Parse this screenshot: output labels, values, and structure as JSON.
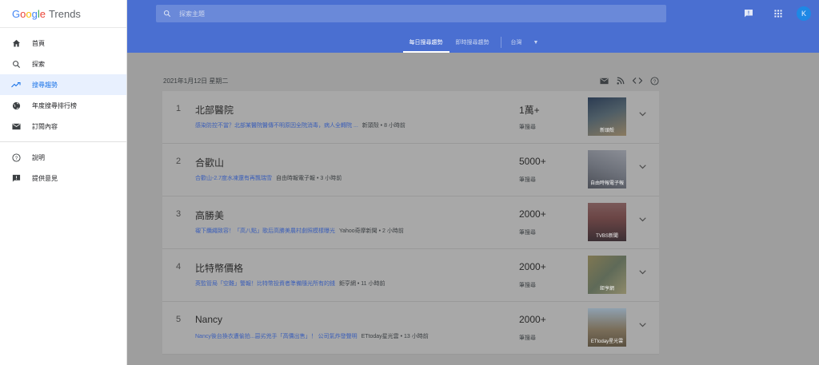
{
  "app": {
    "logo_google": "Google",
    "logo_trends": "Trends",
    "avatar_letter": "K",
    "colors": {
      "header": "#4a6fd1",
      "accent": "#1a73e8",
      "link": "#3c5fb8"
    }
  },
  "sidebar": {
    "items": [
      {
        "label": "首頁",
        "icon": "home-icon"
      },
      {
        "label": "探索",
        "icon": "search-icon"
      },
      {
        "label": "搜尋趨勢",
        "icon": "trending-icon",
        "active": true
      },
      {
        "label": "年度搜尋排行榜",
        "icon": "globe-icon"
      },
      {
        "label": "訂閱內容",
        "icon": "mail-icon"
      }
    ],
    "secondary": [
      {
        "label": "說明",
        "icon": "help-icon"
      },
      {
        "label": "提供意見",
        "icon": "feedback-icon"
      }
    ]
  },
  "header": {
    "search_placeholder": "探索主題",
    "tabs": [
      {
        "label": "每日搜尋趨勢",
        "active": true
      },
      {
        "label": "即時搜尋趨勢",
        "active": false
      }
    ],
    "region": "台灣"
  },
  "main": {
    "date": "2021年1月12日 星期二",
    "count_label": "筆搜尋",
    "trends": [
      {
        "rank": "1",
        "term": "北部醫院",
        "headline": "感染防控不當？北部某醫院醫傳不明原因全院消毒，病人全轉院 ...",
        "source": "新頭殼 • 8 小時前",
        "count": "1萬+",
        "thumb_caption": "新頭殼"
      },
      {
        "rank": "2",
        "term": "合歡山",
        "headline": "合歡山-2.7度水凍還有再飄瑞雪",
        "source": "自由時報電子報 • 3 小時前",
        "count": "5000+",
        "thumb_caption": "自由時報電子報"
      },
      {
        "rank": "3",
        "term": "高勝美",
        "headline": "襯下纜繩致容！「高八點」歌后高勝美農村劇照模樣曝光",
        "source": "Yahoo奇摩新聞 • 2 小時前",
        "count": "2000+",
        "thumb_caption": "TVBS新聞"
      },
      {
        "rank": "4",
        "term": "比特幣價格",
        "headline": "英監管局「空難」警報！比特幣投資者準備隨光所有的錢",
        "source": "鉅亨網 • 11 小時前",
        "count": "2000+",
        "thumb_caption": "鉅亨網"
      },
      {
        "rank": "5",
        "term": "Nancy",
        "headline": "Nancy後台換衣遭偷拍...惡劣兇手「高價出售」！ 公司氣炸發聲明",
        "source": "ETtoday星光雲 • 13 小時前",
        "count": "2000+",
        "thumb_caption": "ETtoday星光雲"
      }
    ]
  }
}
